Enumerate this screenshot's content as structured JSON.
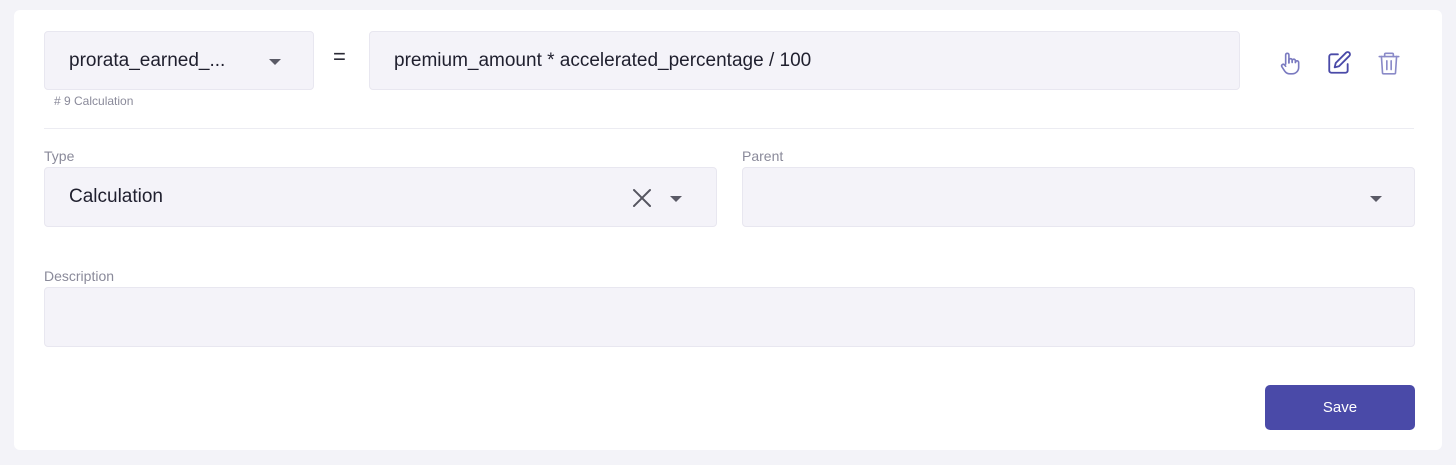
{
  "formula": {
    "variable_select": {
      "value": "prorata_earned_..."
    },
    "equals": "=",
    "expression": "premium_amount * accelerated_percentage / 100",
    "hint": "# 9 Calculation"
  },
  "actions": {
    "icons": [
      "pointer-hand-icon",
      "edit-icon",
      "trash-icon"
    ]
  },
  "type_field": {
    "label": "Type",
    "value": "Calculation"
  },
  "parent_field": {
    "label": "Parent",
    "value": ""
  },
  "description_field": {
    "label": "Description",
    "value": ""
  },
  "save_button": {
    "label": "Save"
  },
  "colors": {
    "accent": "#4a4aa8",
    "field_bg": "#f4f3f9",
    "icon": "#6b6bb8"
  }
}
